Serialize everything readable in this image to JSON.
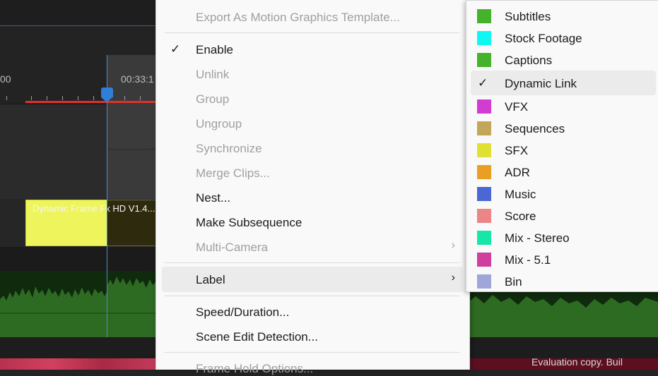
{
  "timeline": {
    "time_left": "00",
    "time_right": "00:33:1",
    "clip_label": "Dynamic Frame Fx HD V1.4...",
    "watermark": "Evaluation copy. Buil"
  },
  "context_menu": {
    "export_motion": "Export As Motion Graphics Template...",
    "enable": "Enable",
    "check": "✓",
    "unlink": "Unlink",
    "group": "Group",
    "ungroup": "Ungroup",
    "synchronize": "Synchronize",
    "merge_clips": "Merge Clips...",
    "nest": "Nest...",
    "make_subsequence": "Make Subsequence",
    "multi_camera": "Multi-Camera",
    "label": "Label",
    "speed_duration": "Speed/Duration...",
    "scene_edit_detection": "Scene Edit Detection...",
    "frame_hold_options": "Frame Hold Options...",
    "chevron": "›"
  },
  "label_submenu": {
    "check": "✓",
    "items": [
      {
        "name": "Subtitles",
        "color": "#45b32a"
      },
      {
        "name": "Stock Footage",
        "color": "#0ff7f1"
      },
      {
        "name": "Captions",
        "color": "#45b32a"
      },
      {
        "name": "Dynamic Link",
        "color": "",
        "checked": true
      },
      {
        "name": "VFX",
        "color": "#d33cd3"
      },
      {
        "name": "Sequences",
        "color": "#c2a659"
      },
      {
        "name": "SFX",
        "color": "#e0e033"
      },
      {
        "name": "ADR",
        "color": "#e99e24"
      },
      {
        "name": "Music",
        "color": "#4b67d4"
      },
      {
        "name": "Score",
        "color": "#ec8585"
      },
      {
        "name": "Mix - Stereo",
        "color": "#16e6a7"
      },
      {
        "name": "Mix - 5.1",
        "color": "#d03e9e"
      },
      {
        "name": "Bin",
        "color": "#9ea7d8"
      }
    ]
  }
}
